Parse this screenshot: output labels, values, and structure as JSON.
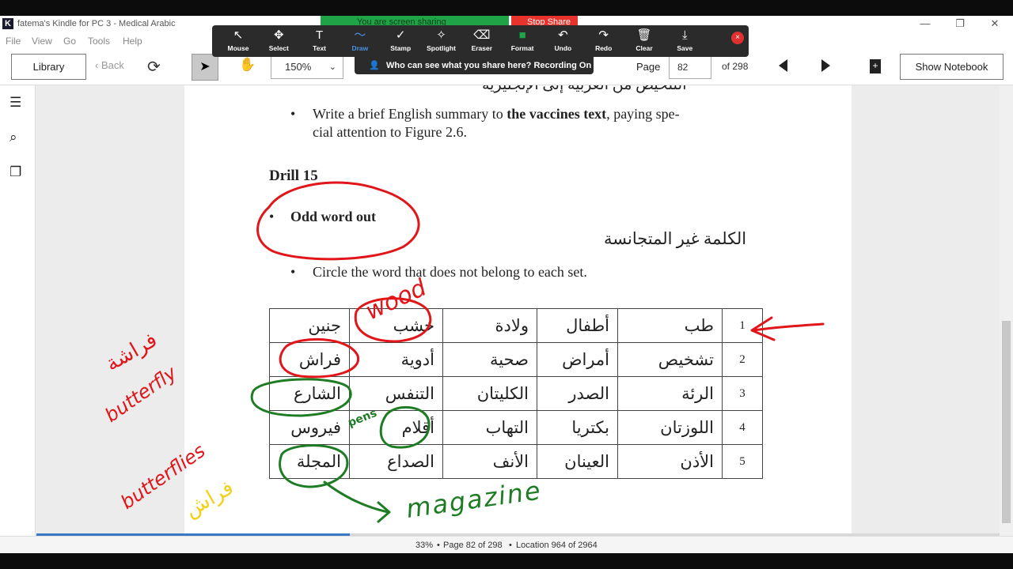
{
  "window": {
    "title": "fatema's Kindle for PC 3 - Medical Arabic",
    "logo": "K",
    "minimize": "—",
    "restore": "❐",
    "close": "✕"
  },
  "menu": [
    "File",
    "View",
    "Go",
    "Tools",
    "Help"
  ],
  "toolbar": {
    "library": "Library",
    "back": "Back",
    "zoom": "150%",
    "page_label": "Page",
    "page_value": "82",
    "page_of": "of 298",
    "show_notebook": "Show Notebook"
  },
  "zoom_share": {
    "banner": "You are screen sharing",
    "stop_share": "Stop Share",
    "who_can_see": "Who can see what you share here? Recording On",
    "tools": [
      {
        "label": "Mouse",
        "icon": "↖"
      },
      {
        "label": "Select",
        "icon": "✥"
      },
      {
        "label": "Text",
        "icon": "T"
      },
      {
        "label": "Draw",
        "icon": "〜"
      },
      {
        "label": "Stamp",
        "icon": "✓"
      },
      {
        "label": "Spotlight",
        "icon": "✧"
      },
      {
        "label": "Eraser",
        "icon": "⌫"
      },
      {
        "label": "Format",
        "icon": "■"
      },
      {
        "label": "Undo",
        "icon": "↶"
      },
      {
        "label": "Redo",
        "icon": "↷"
      },
      {
        "label": "Clear",
        "icon": "🗑"
      },
      {
        "label": "Save",
        "icon": "⤓"
      }
    ],
    "close": "×",
    "active_tool": "Draw",
    "active_color": "#4a90e2",
    "format_color": "#1fa347"
  },
  "page": {
    "top_arabic_partial": "التلخيص من العربية إلى الإنجليزية",
    "summary_bullet_1a_pre": "Write a brief English summary to ",
    "summary_bullet_1a_bold": "the vaccines text",
    "summary_bullet_1a_post": ", paying spe-",
    "summary_bullet_1b": "cial attention to Figure 2.6.",
    "drill_title": "Drill 15",
    "odd_word_out": "Odd word out",
    "arabic_heading": "الكلمة غير المتجانسة",
    "instruction": "Circle the word that does not belong to each set.",
    "rows": [
      {
        "num": "1",
        "words": [
          "طب",
          "أطفال",
          "ولادة",
          "خشب",
          "جنين"
        ]
      },
      {
        "num": "2",
        "words": [
          "تشخيص",
          "أمراض",
          "صحية",
          "أدوية",
          "فراش"
        ]
      },
      {
        "num": "3",
        "words": [
          "الرئة",
          "الصدر",
          "الكليتان",
          "التنفس",
          "الشارع"
        ]
      },
      {
        "num": "4",
        "words": [
          "اللوزتان",
          "بكتريا",
          "التهاب",
          "أقلام",
          "فيروس"
        ]
      },
      {
        "num": "5",
        "words": [
          "الأذن",
          "العينان",
          "الأنف",
          "الصداع",
          "المجلة"
        ]
      }
    ]
  },
  "annotations": {
    "wood": "wood",
    "pens": "pens",
    "magazine": "magazine",
    "butterfly": "butterfly",
    "butterflies": "butterflies",
    "arabic_1": "فراشة",
    "arabic_2": "فراش",
    "red": "#e0161a",
    "green": "#1e7d24",
    "yellow": "#f2d01a"
  },
  "status": {
    "zoom": "33%",
    "page": "Page 82 of 298",
    "location": "Location 964 of 2964",
    "progress_fraction": 0.325
  }
}
